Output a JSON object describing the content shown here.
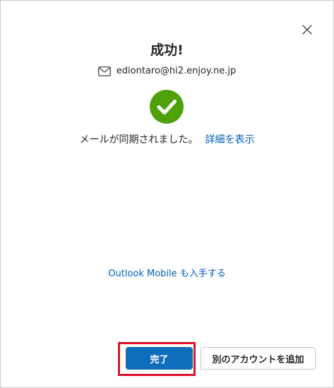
{
  "dialog": {
    "title": "成功!",
    "email": "ediontaro@hi2.enjoy.ne.jp",
    "status_text": "メールが同期されました。",
    "details_link": "詳細を表示",
    "mobile_link": "Outlook Mobile も入手する",
    "done_button": "完了",
    "add_account_button": "別のアカウントを追加",
    "icons": {
      "close": "close-icon",
      "mail": "mail-icon",
      "success": "success-check-icon"
    }
  },
  "colors": {
    "accent": "#0f6cbd",
    "success": "#4ea109",
    "link": "#005fb8",
    "highlight": "#e0112b"
  }
}
